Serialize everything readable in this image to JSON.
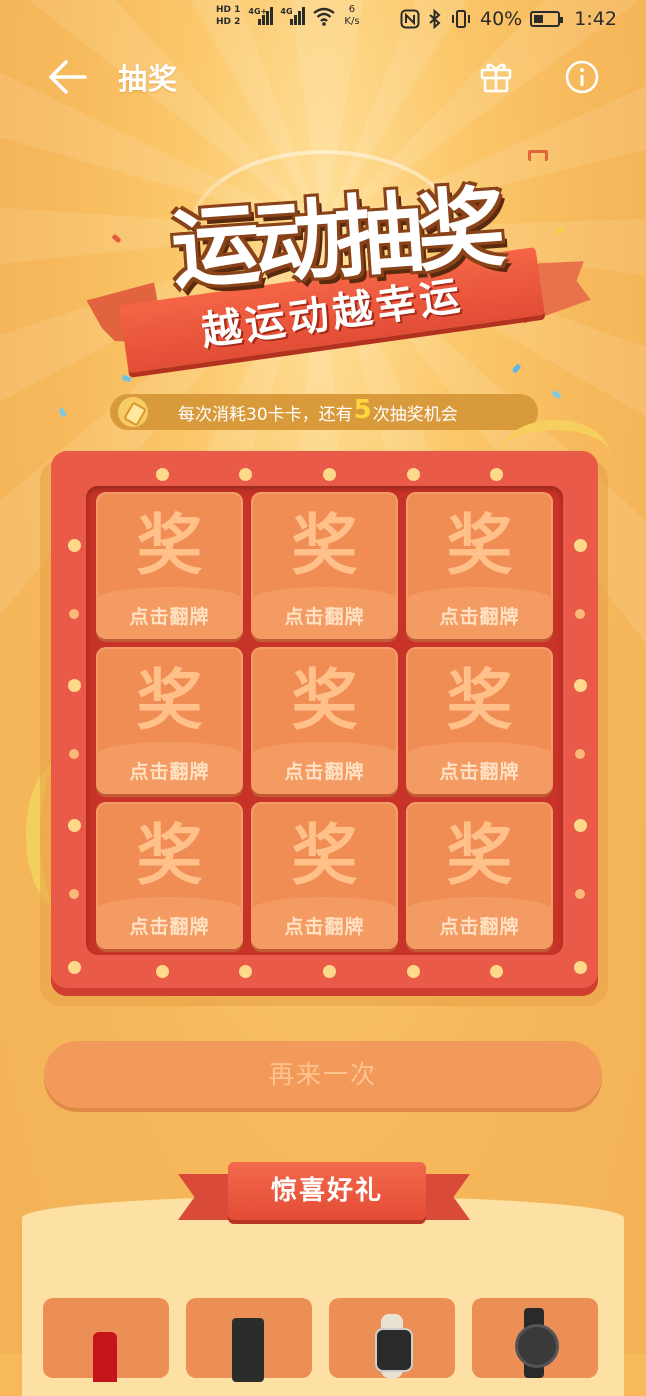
{
  "status_bar": {
    "hd1": "HD 1",
    "hd2": "HD 2",
    "net1": "4G+",
    "net2": "4G",
    "speed_value": "6",
    "speed_unit": "K/s",
    "battery": "40%",
    "battery_level": 0.4,
    "time": "1:42"
  },
  "nav": {
    "title": "抽奖"
  },
  "hero": {
    "title": "运动抽奖",
    "ribbon": "越运动越幸运"
  },
  "info": {
    "prefix": "每次消耗30卡卡，还有",
    "count": "5",
    "suffix": "次抽奖机会"
  },
  "cards": [
    {
      "glyph": "奖",
      "label": "点击翻牌"
    },
    {
      "glyph": "奖",
      "label": "点击翻牌"
    },
    {
      "glyph": "奖",
      "label": "点击翻牌"
    },
    {
      "glyph": "奖",
      "label": "点击翻牌"
    },
    {
      "glyph": "奖",
      "label": "点击翻牌"
    },
    {
      "glyph": "奖",
      "label": "点击翻牌"
    },
    {
      "glyph": "奖",
      "label": "点击翻牌"
    },
    {
      "glyph": "奖",
      "label": "点击翻牌"
    },
    {
      "glyph": "奖",
      "label": "点击翻牌"
    }
  ],
  "again_button": "再来一次",
  "gifts": {
    "title": "惊喜好礼",
    "items": [
      "prize-bottle",
      "prize-power-bank",
      "prize-band",
      "prize-watch"
    ]
  },
  "colors": {
    "background": "#f7b95a",
    "board": "#ea5a48",
    "card": "#f08d55",
    "accent": "#ffd640"
  }
}
